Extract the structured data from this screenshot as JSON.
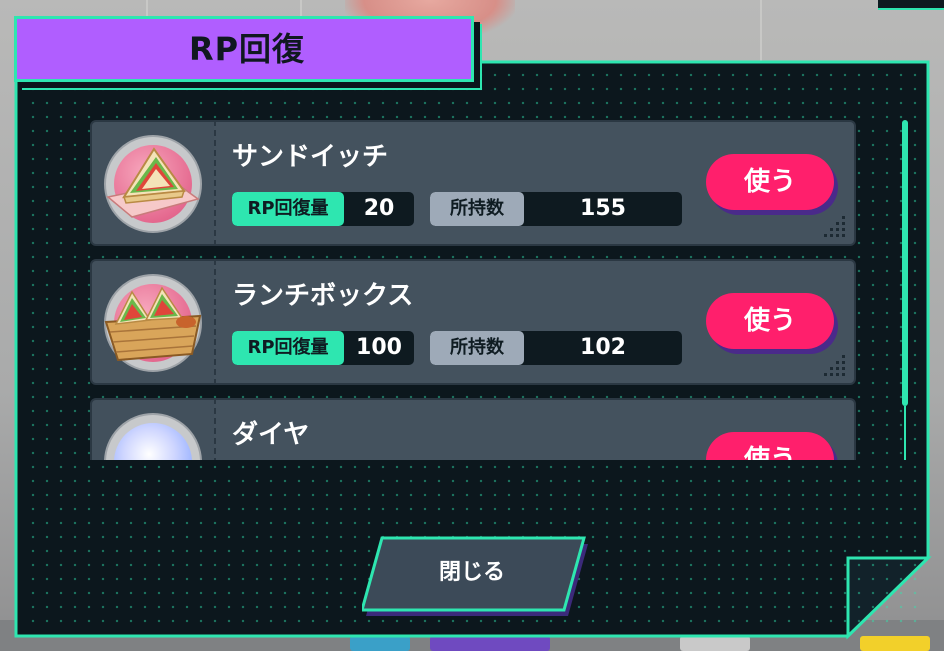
{
  "dialog": {
    "title": "RP回復",
    "close_label": "閉じる"
  },
  "items": [
    {
      "name": "サンドイッチ",
      "rp_label": "RP回復量",
      "rp_value": "20",
      "owned_label": "所持数",
      "owned_value": "155",
      "use_label": "使う",
      "icon": "sandwich-icon"
    },
    {
      "name": "ランチボックス",
      "rp_label": "RP回復量",
      "rp_value": "100",
      "owned_label": "所持数",
      "owned_value": "102",
      "use_label": "使う",
      "icon": "lunchbox-icon"
    },
    {
      "name": "ダイヤ",
      "use_label": "使う",
      "icon": "diamond-icon"
    }
  ],
  "colors": {
    "accent_green": "#2ee6b0",
    "title_purple": "#b05eff",
    "use_pink": "#ff1f6c",
    "panel_dark": "#0e1a20",
    "row_gray": "#44525e"
  }
}
